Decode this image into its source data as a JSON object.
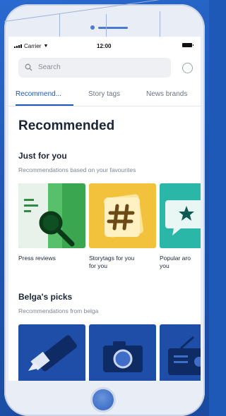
{
  "status_bar": {
    "carrier": "Carrier",
    "time": "12:00"
  },
  "search": {
    "placeholder": "Search"
  },
  "tabs": [
    {
      "label": "Recommend...",
      "active": true
    },
    {
      "label": "Story tags",
      "active": false
    },
    {
      "label": "News brands",
      "active": false
    }
  ],
  "page_title": "Recommended",
  "sections": [
    {
      "title": "Just for you",
      "subtitle": "Recommendations based on your favourites",
      "cards": [
        {
          "label": "Press reviews",
          "icon": "magnifier-document-icon",
          "color": "#3aa64f"
        },
        {
          "label": "Storytags for you for you",
          "label_lines": [
            "Storytags for you",
            "for you"
          ],
          "icon": "hashtag-icon",
          "color": "#f3c23c"
        },
        {
          "label": "Popular aro you",
          "label_lines": [
            "Popular aro",
            "you"
          ],
          "icon": "star-chat-icon",
          "color": "#2bb7a8"
        }
      ]
    },
    {
      "title": "Belga's picks",
      "subtitle": "Recommendations from belga",
      "cards": [
        {
          "icon": "marker-pen-icon",
          "color": "#1f4ea8"
        },
        {
          "icon": "camera-icon",
          "color": "#1f4ea8"
        },
        {
          "icon": "radio-icon",
          "color": "#1f4ea8"
        }
      ]
    }
  ]
}
